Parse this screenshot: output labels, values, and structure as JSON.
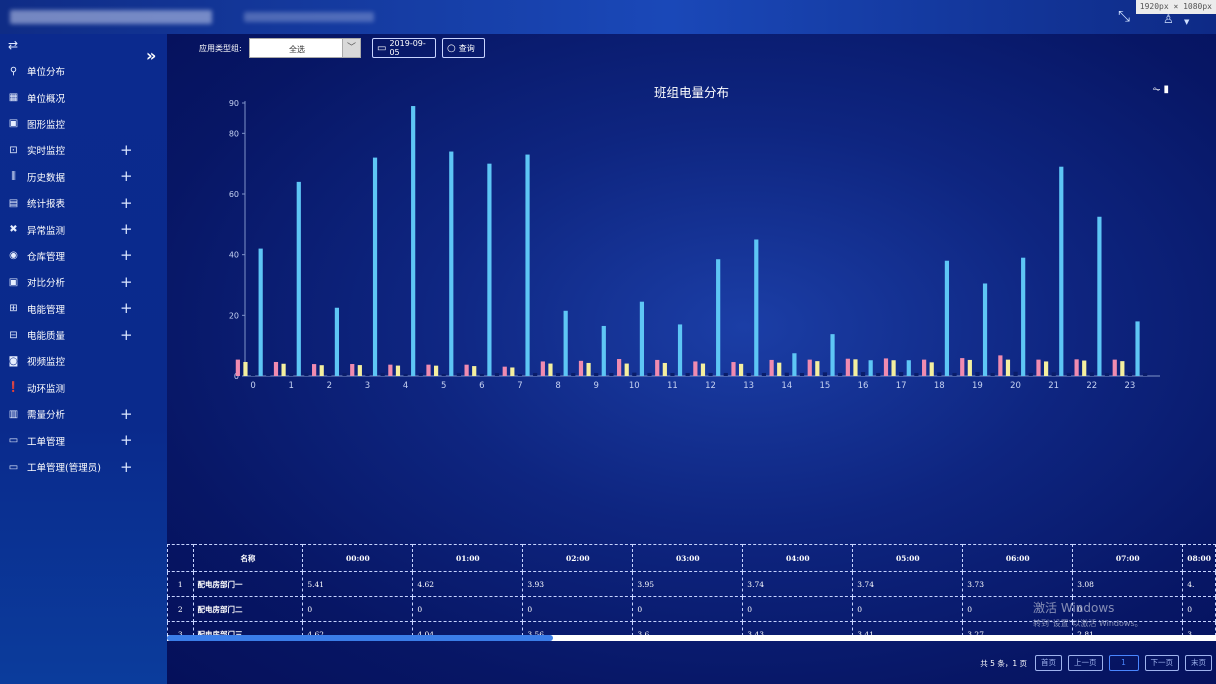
{
  "resolution_badge": "1920px × 1080px",
  "toolbar": {
    "type_group_label": "应用类型组:",
    "type_group_value": "全选",
    "date_value": "2019-09-05",
    "query_label": "查询"
  },
  "sidebar": {
    "items": [
      {
        "label": "单位分布",
        "icon": "location-pin-icon",
        "expandable": false
      },
      {
        "label": "单位概况",
        "icon": "grid-icon",
        "expandable": false
      },
      {
        "label": "图形监控",
        "icon": "monitor-icon",
        "expandable": false
      },
      {
        "label": "实时监控",
        "icon": "search-doc-icon",
        "expandable": true
      },
      {
        "label": "历史数据",
        "icon": "history-icon",
        "expandable": true
      },
      {
        "label": "统计报表",
        "icon": "report-icon",
        "expandable": true
      },
      {
        "label": "异常监测",
        "icon": "alert-circle-icon",
        "expandable": true
      },
      {
        "label": "仓库管理",
        "icon": "warehouse-icon",
        "expandable": true
      },
      {
        "label": "对比分析",
        "icon": "compare-icon",
        "expandable": true
      },
      {
        "label": "电能管理",
        "icon": "energy-icon",
        "expandable": true
      },
      {
        "label": "电能质量",
        "icon": "power-quality-icon",
        "expandable": true
      },
      {
        "label": "视频监控",
        "icon": "camera-icon",
        "expandable": false
      },
      {
        "label": "动环监测",
        "icon": "exclamation-icon",
        "expandable": false
      },
      {
        "label": "需量分析",
        "icon": "demand-icon",
        "expandable": true
      },
      {
        "label": "工单管理",
        "icon": "work-order-icon",
        "expandable": true
      },
      {
        "label": "工单管理(管理员)",
        "icon": "work-order-admin-icon",
        "expandable": true
      }
    ]
  },
  "chart_data": {
    "type": "bar",
    "title": "班组电量分布",
    "ylim": [
      0,
      90
    ],
    "yticks": [
      0,
      20,
      40,
      60,
      80,
      90
    ],
    "categories": [
      "0",
      "1",
      "2",
      "3",
      "4",
      "5",
      "6",
      "7",
      "8",
      "9",
      "10",
      "11",
      "12",
      "13",
      "14",
      "15",
      "16",
      "17",
      "18",
      "19",
      "20",
      "21",
      "22",
      "23"
    ],
    "series": [
      {
        "color": "#f08bb0",
        "values": [
          5.41,
          4.62,
          3.93,
          3.95,
          3.74,
          3.74,
          3.73,
          3.08,
          4.8,
          5,
          5.6,
          5.3,
          4.8,
          4.6,
          5.3,
          5.4,
          5.7,
          5.8,
          5.4,
          5.9,
          6.8,
          5.4,
          5.5,
          5.4
        ]
      },
      {
        "color": "#f4ef9f",
        "values": [
          4.62,
          4.04,
          3.56,
          3.6,
          3.43,
          3.41,
          3.27,
          2.81,
          4.1,
          4.3,
          4.1,
          4.3,
          4.1,
          4,
          4.4,
          4.9,
          5.5,
          5.2,
          4.5,
          5.3,
          5.4,
          4.8,
          5.1,
          4.9
        ]
      },
      {
        "color": "#0a1d6a",
        "values": [
          1.2,
          1,
          0.8,
          0.8,
          0.7,
          0.7,
          0.7,
          0.6,
          1,
          1,
          1.1,
          1,
          1,
          1,
          1.1,
          1.2,
          1.3,
          1.3,
          1.2,
          1.3,
          1.4,
          1.2,
          1.2,
          1.2
        ]
      },
      {
        "color": "#5ec6f5",
        "values": [
          42,
          64,
          22.5,
          72,
          89,
          74,
          70,
          73,
          21.5,
          16.5,
          24.5,
          17,
          38.5,
          45,
          7.5,
          13.8,
          5.2,
          5.2,
          38,
          30.5,
          39,
          69,
          52.5,
          18
        ]
      },
      {
        "color": "#0a1d6a",
        "values": [
          1,
          1,
          1,
          1,
          1,
          1,
          1,
          1,
          1,
          1,
          1,
          1,
          1,
          1,
          1,
          1,
          1,
          1,
          1,
          1,
          1,
          1,
          1,
          1
        ]
      }
    ]
  },
  "table": {
    "headers": [
      "名称",
      "00:00",
      "01:00",
      "02:00",
      "03:00",
      "04:00",
      "05:00",
      "06:00",
      "07:00",
      "08:00"
    ],
    "rows": [
      {
        "index": "1",
        "name": "配电房部门一",
        "values": [
          "5.41",
          "4.62",
          "3.93",
          "3.95",
          "3.74",
          "3.74",
          "3.73",
          "3.08",
          "4."
        ]
      },
      {
        "index": "2",
        "name": "配电房部门二",
        "values": [
          "0",
          "0",
          "0",
          "0",
          "0",
          "0",
          "0",
          "0",
          "0"
        ]
      },
      {
        "index": "3",
        "name": "配电房部门三",
        "values": [
          "4.62",
          "4.04",
          "3.56",
          "3.6",
          "3.43",
          "3.41",
          "3.27",
          "2.81",
          "3."
        ]
      }
    ]
  },
  "watermark": {
    "line1": "激活 Windows",
    "line2": "转到\"设置\"以激活 Windows。"
  },
  "pager": {
    "info": "共 5 条，1 页",
    "first": "首页",
    "prev": "上一页",
    "current": "1",
    "next": "下一页",
    "last": "末页"
  }
}
